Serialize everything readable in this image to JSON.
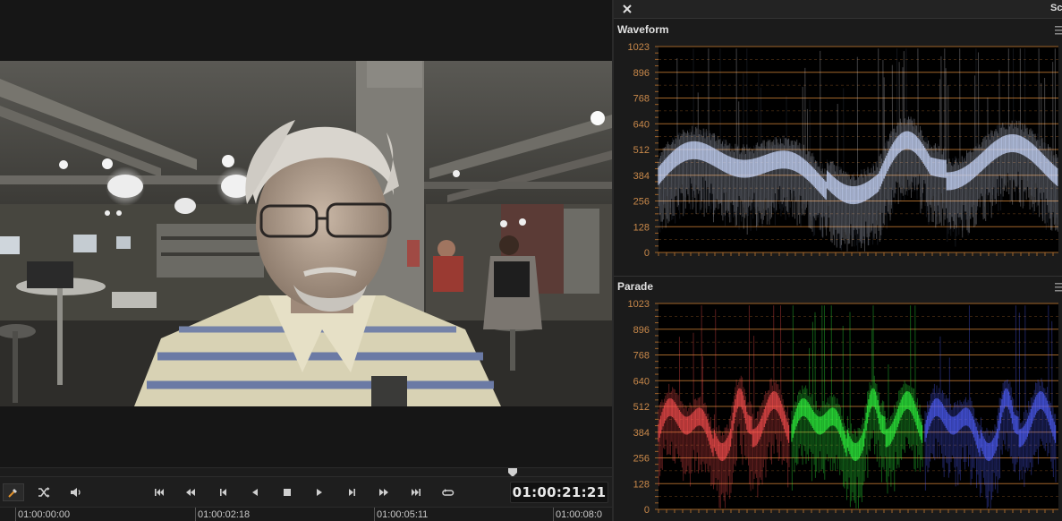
{
  "viewer": {
    "timecode": "01:00:21:21",
    "transport": [
      {
        "name": "jump-to-start",
        "icon": "skip-to-start-icon"
      },
      {
        "name": "rewind",
        "icon": "fast-rewind-icon"
      },
      {
        "name": "prev-frame",
        "icon": "step-back-icon"
      },
      {
        "name": "play-reverse",
        "icon": "play-reverse-icon"
      },
      {
        "name": "stop",
        "icon": "stop-icon"
      },
      {
        "name": "play",
        "icon": "play-icon"
      },
      {
        "name": "next-frame",
        "icon": "step-forward-icon"
      },
      {
        "name": "fast-forward",
        "icon": "fast-forward-icon"
      },
      {
        "name": "jump-to-end",
        "icon": "skip-to-end-icon"
      },
      {
        "name": "loop",
        "icon": "loop-icon"
      }
    ],
    "left_tools": [
      "eyedropper-icon",
      "shuffle-icon",
      "speaker-icon"
    ],
    "ruler": [
      "01:00:00:00",
      "01:00:02:18",
      "01:00:05:11",
      "01:00:08:0"
    ]
  },
  "scopes": {
    "header_title": "Sc",
    "waveform": {
      "title": "Waveform",
      "scale": [
        "1023",
        "896",
        "768",
        "640",
        "512",
        "384",
        "256",
        "128",
        "0"
      ]
    },
    "parade": {
      "title": "Parade",
      "scale": [
        "1023",
        "896",
        "768",
        "640",
        "512",
        "384",
        "256",
        "128",
        "0"
      ],
      "channels": [
        "red",
        "green",
        "blue"
      ]
    },
    "colors": {
      "grid": "#a0642a",
      "scale_text": "#c8884a",
      "red_trace": "#ff5050",
      "green_trace": "#30ff40",
      "blue_trace": "#5060ff"
    }
  }
}
